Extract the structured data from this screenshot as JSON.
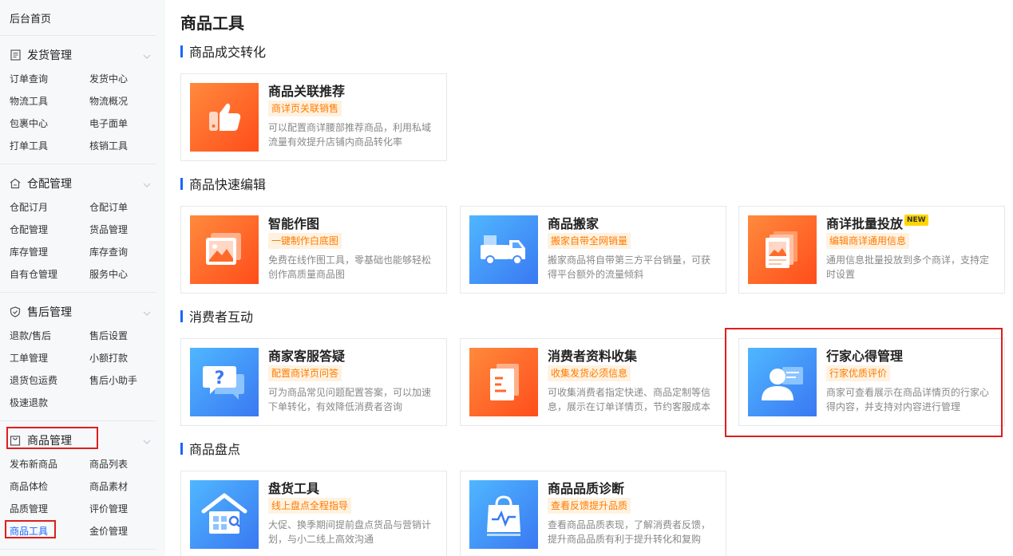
{
  "sidebar": {
    "home": "后台首页",
    "sections": [
      {
        "title": "发货管理",
        "icon": "document-icon",
        "items": [
          "订单查询",
          "发货中心",
          "物流工具",
          "物流概况",
          "包裹中心",
          "电子面单",
          "打单工具",
          "核销工具"
        ]
      },
      {
        "title": "仓配管理",
        "icon": "warehouse-icon",
        "items": [
          "仓配订月",
          "仓配订单",
          "仓配管理",
          "货品管理",
          "库存管理",
          "库存查询",
          "自有仓管理",
          "服务中心"
        ]
      },
      {
        "title": "售后管理",
        "icon": "shield-icon",
        "items": [
          "退款/售后",
          "售后设置",
          "工单管理",
          "小额打款",
          "退货包运费",
          "售后小助手",
          "极速退款"
        ]
      },
      {
        "title": "商品管理",
        "icon": "bag-icon",
        "items": [
          "发布新商品",
          "商品列表",
          "商品体检",
          "商品素材",
          "品质管理",
          "评价管理",
          "商品工具",
          "金价管理"
        ]
      }
    ],
    "active_item": "商品工具"
  },
  "main": {
    "title": "商品工具",
    "sections": [
      {
        "title": "商品成交转化",
        "cards": [
          {
            "title": "商品关联推荐",
            "tag": "商详页关联销售",
            "desc": "可以配置商详腰部推荐商品，利用私域流量有效提升店铺内商品转化率",
            "icon": "thumbs-up-icon",
            "color": "orange"
          }
        ]
      },
      {
        "title": "商品快速编辑",
        "cards": [
          {
            "title": "智能作图",
            "tag": "一键制作白底图",
            "desc": "免费在线作图工具，零基础也能够轻松创作高质量商品图",
            "icon": "image-icon",
            "color": "orange"
          },
          {
            "title": "商品搬家",
            "tag": "搬家自带全网销量",
            "desc": "搬家商品将自带第三方平台销量，可获得平台额外的流量倾斜",
            "icon": "truck-icon",
            "color": "blue"
          },
          {
            "title": "商详批量投放",
            "tag": "编辑商详通用信息",
            "desc": "通用信息批量投放到多个商详，支持定时设置",
            "icon": "stacked-images-icon",
            "color": "orange",
            "badge": "NEW"
          }
        ]
      },
      {
        "title": "消费者互动",
        "cards": [
          {
            "title": "商家客服答疑",
            "tag": "配置商详页问答",
            "desc": "可为商品常见问题配置答案，可以加速下单转化，有效降低消费者咨询",
            "icon": "question-chat-icon",
            "color": "blue"
          },
          {
            "title": "消费者资料收集",
            "tag": "收集发货必须信息",
            "desc": "可收集消费者指定快递、商品定制等信息，展示在订单详情页，节约客服成本",
            "icon": "form-icon",
            "color": "orange"
          },
          {
            "title": "行家心得管理",
            "tag": "行家优质评价",
            "desc": "商家可查看展示在商品详情页的行家心得内容，并支持对内容进行管理",
            "icon": "user-card-icon",
            "color": "blue"
          }
        ]
      },
      {
        "title": "商品盘点",
        "cards": [
          {
            "title": "盘货工具",
            "tag": "线上盘点全程指导",
            "desc": "大促、换季期间提前盘点货品与营销计划，与小二线上高效沟通",
            "icon": "store-search-icon",
            "color": "blue"
          },
          {
            "title": "商品品质诊断",
            "tag": "查看反馈提升品质",
            "desc": "查看商品品质表现，了解消费者反馈，提升商品品质有利于提升转化和复购",
            "icon": "bag-pulse-icon",
            "color": "blue"
          }
        ]
      }
    ]
  }
}
